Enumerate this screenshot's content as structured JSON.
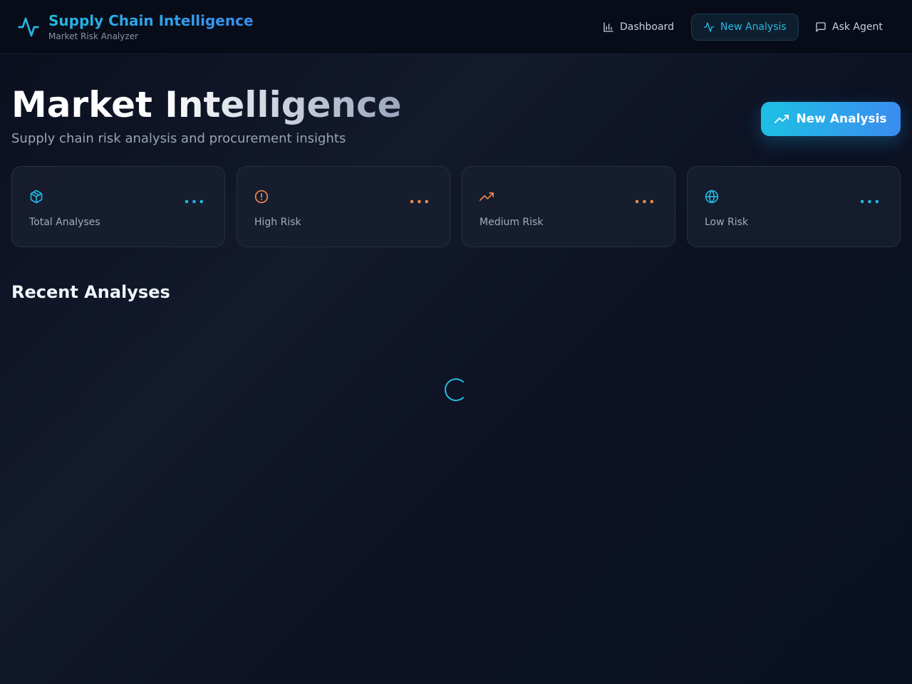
{
  "header": {
    "title": "Supply Chain Intelligence",
    "subtitle": "Market Risk Analyzer",
    "logo_icon": "activity-icon",
    "nav": [
      {
        "label": "Dashboard",
        "icon": "bar-chart-icon",
        "active": false
      },
      {
        "label": "New Analysis",
        "icon": "activity-icon",
        "active": true
      },
      {
        "label": "Ask Agent",
        "icon": "message-square-icon",
        "active": false
      }
    ]
  },
  "hero": {
    "title": "Market Intelligence",
    "subtitle": "Supply chain risk analysis and procurement insights",
    "cta_label": "New Analysis",
    "cta_icon": "trending-up-icon"
  },
  "stats": [
    {
      "label": "Total Analyses",
      "value": "...",
      "icon": "package-icon",
      "color": "#22b8e0"
    },
    {
      "label": "High Risk",
      "value": "...",
      "icon": "alert-circle-icon",
      "color": "#f0884a"
    },
    {
      "label": "Medium Risk",
      "value": "...",
      "icon": "trending-up-icon",
      "color": "#f0884a"
    },
    {
      "label": "Low Risk",
      "value": "...",
      "icon": "globe-icon",
      "color": "#22b8e0"
    }
  ],
  "recent": {
    "title": "Recent Analyses",
    "loading": true
  },
  "colors": {
    "accent": "#22b8e0",
    "warning": "#f0884a",
    "background": "#0a0f1e"
  }
}
